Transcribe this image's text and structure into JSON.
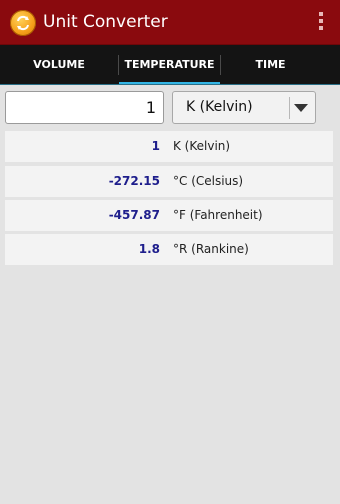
{
  "app": {
    "title": "Unit Converter",
    "icon": "swap-arrows-icon",
    "accent": "#8a0a0e"
  },
  "tabs": [
    {
      "label": "VOLUME",
      "active": false
    },
    {
      "label": "TEMPERATURE",
      "active": true
    },
    {
      "label": "TIME",
      "active": false
    }
  ],
  "input": {
    "value": "1"
  },
  "unit_select": {
    "selected": "K (Kelvin)"
  },
  "results": [
    {
      "value": "1",
      "unit": "K (Kelvin)"
    },
    {
      "value": "-272.15",
      "unit": "°C (Celsius)"
    },
    {
      "value": "-457.87",
      "unit": "°F (Fahrenheit)"
    },
    {
      "value": "1.8",
      "unit": "°R (Rankine)"
    }
  ],
  "colors": {
    "tab_indicator": "#33b5e5",
    "value_text": "#1e1e8c"
  }
}
